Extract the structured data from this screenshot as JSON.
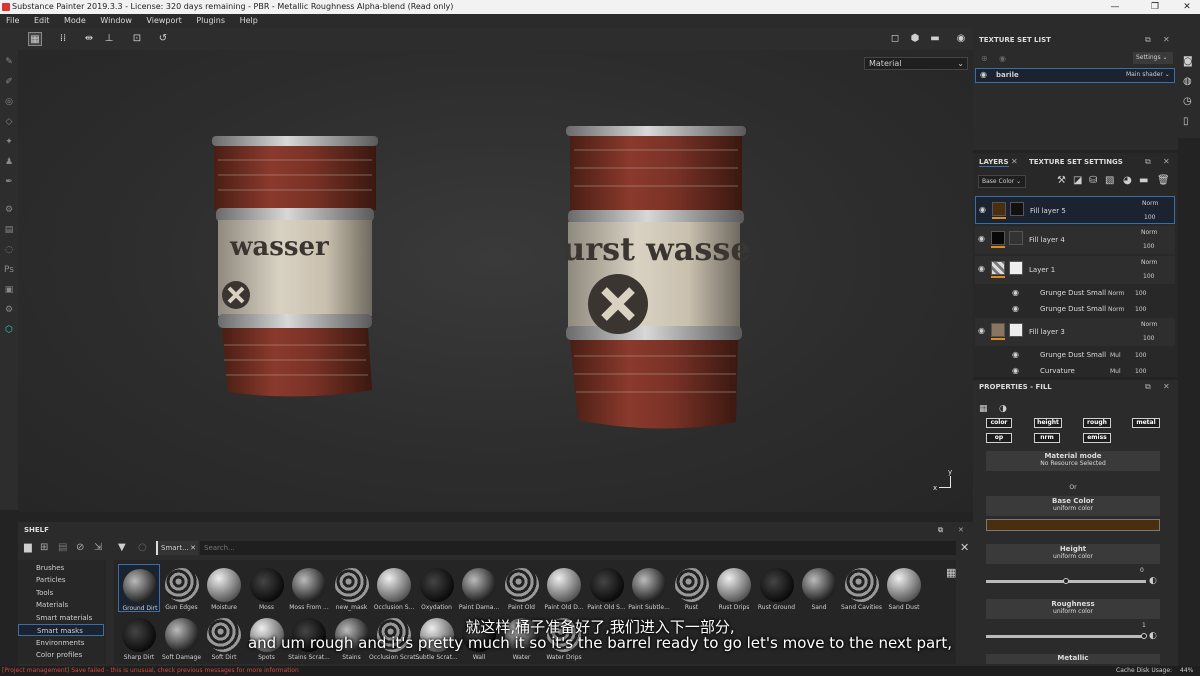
{
  "window": {
    "title": "Substance Painter 2019.3.3 - License: 320 days remaining - PBR - Metallic Roughness Alpha-blend (Read only)",
    "controls": [
      "—",
      "❐",
      "✕"
    ]
  },
  "menu": [
    "File",
    "Edit",
    "Mode",
    "Window",
    "Viewport",
    "Plugins",
    "Help"
  ],
  "viewport": {
    "material_select": "Material",
    "axis_y": "y",
    "axis_x": "x",
    "barrel_left_label": "wasser",
    "barrel_right_label": "urst wasse"
  },
  "texture_set_list": {
    "title": "TEXTURE SET LIST",
    "settings": "Settings",
    "set_name": "barile",
    "shader": "Main shader"
  },
  "layers_panel": {
    "tab_layers": "LAYERS",
    "tab_settings": "TEXTURE SET SETTINGS",
    "channel": "Base Color",
    "layers": [
      {
        "name": "Fill layer 5",
        "blend": "Norm",
        "opacity": "100"
      },
      {
        "name": "Fill layer 4",
        "blend": "Norm",
        "opacity": "100"
      },
      {
        "name": "Layer 1",
        "blend": "Norm",
        "opacity": "100"
      },
      {
        "name": "Grunge Dust Small",
        "blend": "Norm",
        "opacity": "100"
      },
      {
        "name": "Grunge Dust Small",
        "blend": "Norm",
        "opacity": "100"
      },
      {
        "name": "Fill layer 3",
        "blend": "Norm",
        "opacity": "100"
      },
      {
        "name": "Grunge Dust Small",
        "blend": "Mul",
        "opacity": "100"
      },
      {
        "name": "Curvature",
        "blend": "Mul",
        "opacity": "100"
      }
    ]
  },
  "properties": {
    "title": "PROPERTIES - FILL",
    "channels_row1": [
      "color",
      "height",
      "rough",
      "metal"
    ],
    "channels_row2": [
      "op",
      "nrm",
      "emiss"
    ],
    "material_mode": "Material mode",
    "no_resource": "No Resource Selected",
    "or": "Or",
    "base_color": "Base Color",
    "base_color_sub": "uniform color",
    "height": "Height",
    "height_sub": "uniform color",
    "height_value": "0",
    "roughness": "Roughness",
    "roughness_sub": "uniform color",
    "roughness_value": "1",
    "metallic": "Metallic",
    "base_color_hex": "#4a2e10"
  },
  "shelf": {
    "title": "SHELF",
    "filter_tag": "Smart...",
    "search_placeholder": "Search...",
    "categories": [
      "Brushes",
      "Particles",
      "Tools",
      "Materials",
      "Smart materials",
      "Smart masks",
      "Environments",
      "Color profiles"
    ],
    "selected_category": "Smart masks",
    "row1": [
      "Ground Dirt",
      "Gun Edges",
      "Moisture",
      "Moss",
      "Moss From ...",
      "new_mask",
      "Occlusion S...",
      "Oxydation",
      "Paint Dama...",
      "Paint Old",
      "Paint Old D...",
      "Paint Old S...",
      "Paint Subtle...",
      "Rust",
      "Rust Drips",
      "Rust Ground",
      "Sand",
      "Sand Cavities",
      "Sand Dust"
    ],
    "row2": [
      "Sharp Dirt",
      "Soft Damage",
      "Soft Dirt",
      "Spots",
      "Stains Scrat...",
      "Stains",
      "Occlusion Scrat...",
      "Subtle Scrat...",
      "Wall",
      "Water",
      "Water Drips"
    ]
  },
  "subtitles": {
    "cn": "就这样,桶子准备好了,我们进入下一部分,",
    "en": "and um rough and it's pretty much it so it's the barrel ready to go let's move to the next part,"
  },
  "status": {
    "message": "[Project management] Save failed - this is unusual, check previous messages for more information",
    "cache_label": "Cache Disk Usage:",
    "cache_value": "44%"
  },
  "colors": {
    "accent": "#3b6ea5",
    "status_error": "#d04a3a",
    "orange_bar": "#e08a1e"
  }
}
